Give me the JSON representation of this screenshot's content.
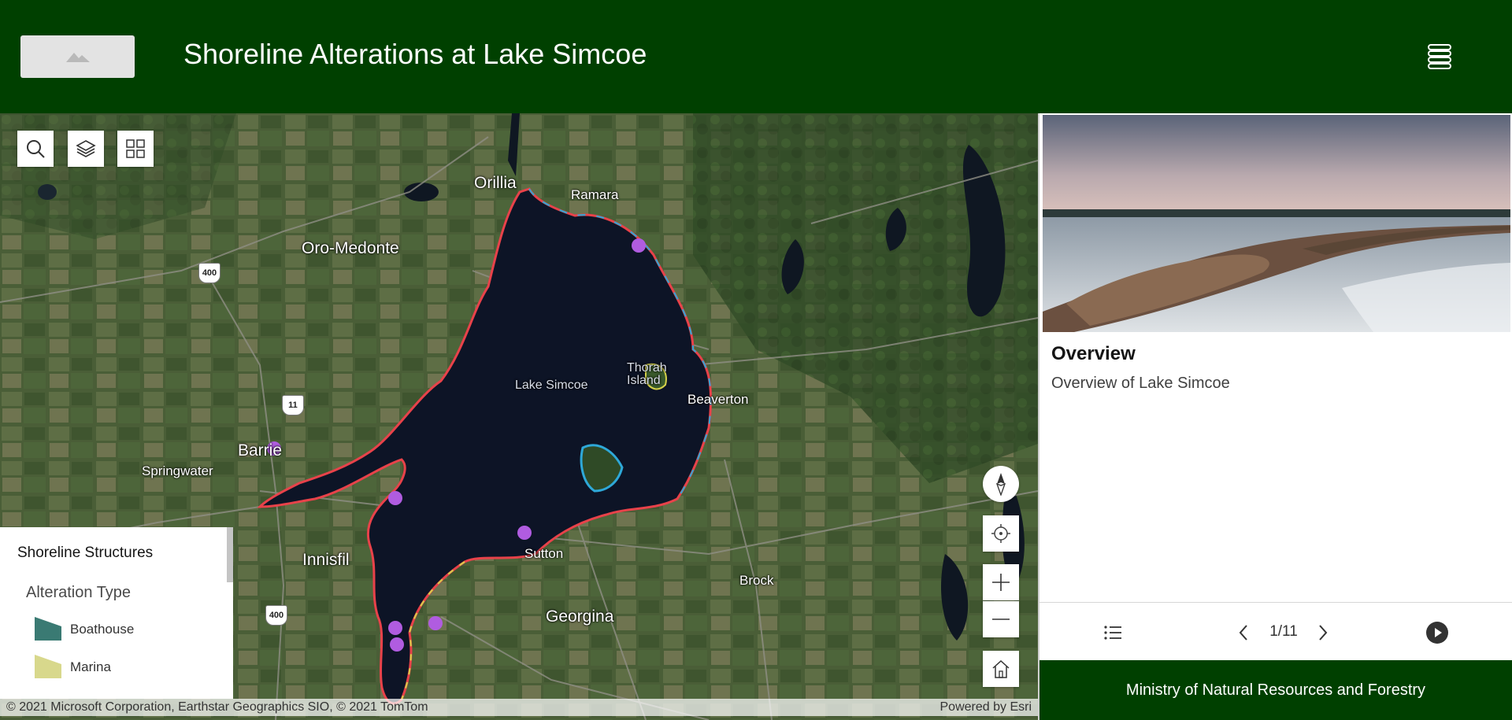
{
  "header": {
    "title": "Shoreline Alterations at Lake Simcoe",
    "logo_icon": "image-placeholder-icon",
    "menu_icon": "menu-icon",
    "background": "#004000"
  },
  "map": {
    "tools": [
      {
        "name": "search-icon"
      },
      {
        "name": "layers-icon"
      },
      {
        "name": "basemap-gallery-icon"
      }
    ],
    "places": {
      "orillia": "Orillia",
      "ramara": "Ramara",
      "oro_medonte": "Oro-Medonte",
      "lake_simcoe": "Lake Simcoe",
      "thorah_island": "Thorah Island",
      "beaverton": "Beaverton",
      "barrie": "Barrie",
      "springwater": "Springwater",
      "innisfil": "Innisfil",
      "sutton": "Sutton",
      "brock": "Brock",
      "georgina": "Georgina"
    },
    "highways": {
      "h400_north": "400",
      "h11": "11",
      "h400_south": "400"
    },
    "attribution": "© 2021 Microsoft Corporation, Earthstar Geographics SIO, © 2021 TomTom",
    "powered_by": "Powered by Esri",
    "controls": [
      "compass-icon",
      "locate-icon",
      "zoom-in-icon",
      "zoom-out-icon",
      "home-icon"
    ],
    "colors": {
      "lake": "#0d1426",
      "shoreline_red": "#e8424a",
      "shoreline_blue": "#2ea8d8",
      "shoreline_yellow": "#d6d24a",
      "point_purple": "#b05ce0"
    }
  },
  "legend": {
    "title": "Shoreline Structures",
    "subtitle": "Alteration Type",
    "items": [
      {
        "label": "Boathouse",
        "color": "#3a7a73"
      },
      {
        "label": "Marina",
        "color": "#d8d88c"
      }
    ]
  },
  "panel": {
    "card_title": "Overview",
    "card_subtitle": "Overview of Lake Simcoe",
    "page_indicator": "1/11",
    "footer": "Ministry of Natural Resources and Forestry"
  }
}
